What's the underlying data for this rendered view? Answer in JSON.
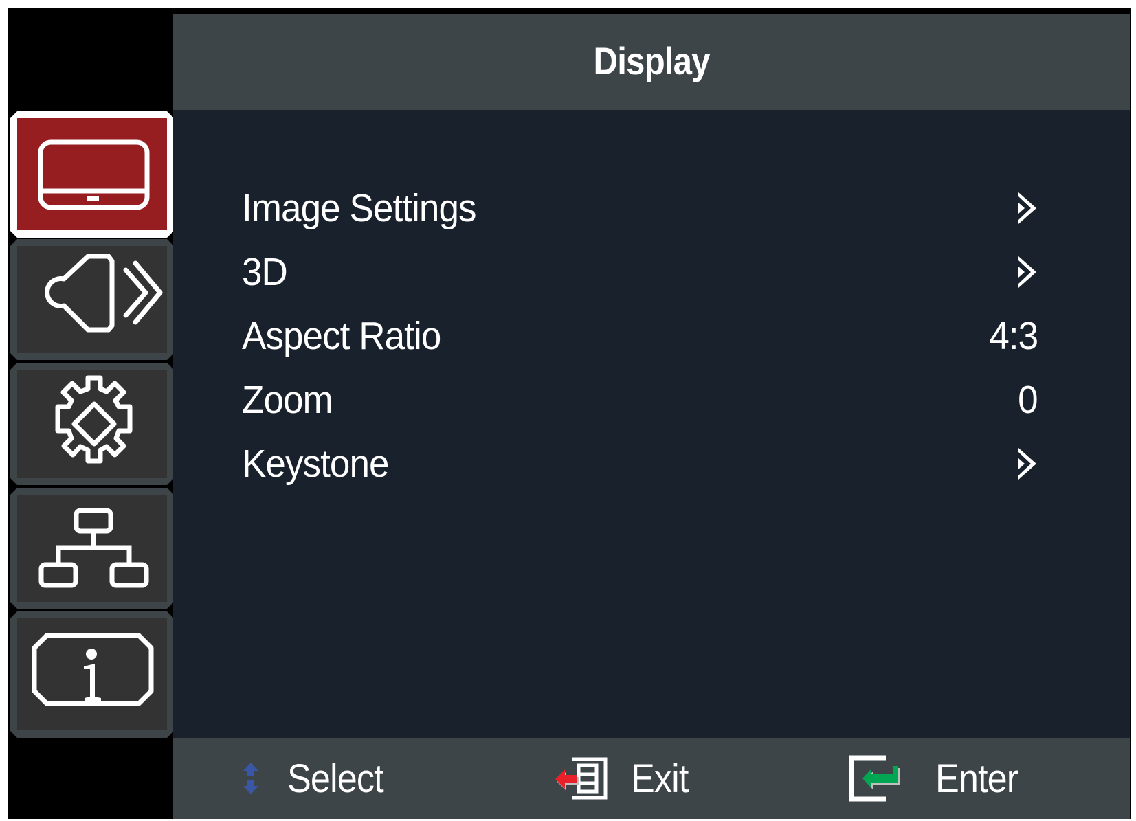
{
  "header": {
    "title": "Display"
  },
  "sidebar": {
    "items": [
      {
        "id": "display",
        "icon": "display-icon",
        "selected": true
      },
      {
        "id": "audio",
        "icon": "speaker-icon",
        "selected": false
      },
      {
        "id": "system",
        "icon": "gear-icon",
        "selected": false
      },
      {
        "id": "network",
        "icon": "network-icon",
        "selected": false
      },
      {
        "id": "information",
        "icon": "info-icon",
        "selected": false
      }
    ]
  },
  "menu": {
    "items": [
      {
        "label": "Image Settings",
        "value": null,
        "indicator": "chevron-right-icon"
      },
      {
        "label": "3D",
        "value": null,
        "indicator": "chevron-right-icon"
      },
      {
        "label": "Aspect Ratio",
        "value": "4:3",
        "indicator": null
      },
      {
        "label": "Zoom",
        "value": "0",
        "indicator": null
      },
      {
        "label": "Keystone",
        "value": null,
        "indicator": "chevron-right-icon"
      }
    ]
  },
  "footer": {
    "select": {
      "label": "Select",
      "icon": "up-down-arrows-icon"
    },
    "exit": {
      "label": "Exit",
      "icon": "exit-icon"
    },
    "enter": {
      "label": "Enter",
      "icon": "enter-icon"
    }
  },
  "colors": {
    "header_bg": "#3e4548",
    "main_bg": "#19212c",
    "selected_tile": "#961e21",
    "tile_bg": "#333333",
    "select_arrow": "#3a56a6",
    "exit_arrow": "#e8202a",
    "enter_arrow": "#00a651"
  }
}
